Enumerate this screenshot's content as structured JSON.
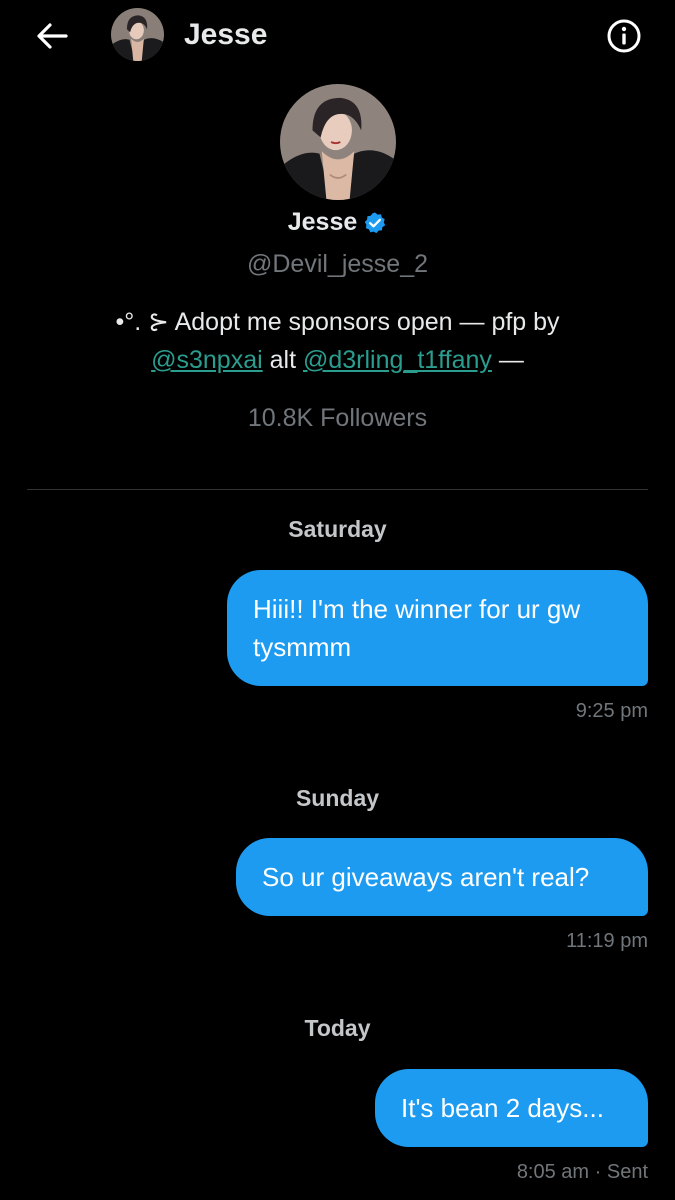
{
  "header": {
    "name": "Jesse"
  },
  "profile": {
    "name": "Jesse",
    "verified": true,
    "handle": "@Devil_jesse_2",
    "bio": {
      "prefix": "•°. ⊱ Adopt me sponsors open — pfp by ",
      "link1": "@s3npxai",
      "middle": " alt ",
      "link2": "@d3rling_t1ffany",
      "suffix": " —"
    },
    "followers": "10.8K Followers"
  },
  "conversation": [
    {
      "day": "Saturday",
      "message": "Hiii!! I'm the winner for ur gw tysmmm",
      "time": "9:25 pm"
    },
    {
      "day": "Sunday",
      "message": "So ur giveaways aren't real?",
      "time": "11:19 pm"
    },
    {
      "day": "Today",
      "message": "It's bean 2 days...",
      "time": "8:05 am · Sent"
    }
  ],
  "colors": {
    "background": "#000000",
    "bubble": "#1d9bf0",
    "link": "#2a9d8f",
    "muted": "#71767b",
    "verified": "#1d9bf0"
  },
  "icons": {
    "back": "arrow-left-icon",
    "info": "info-icon",
    "verified": "verified-badge-icon"
  }
}
